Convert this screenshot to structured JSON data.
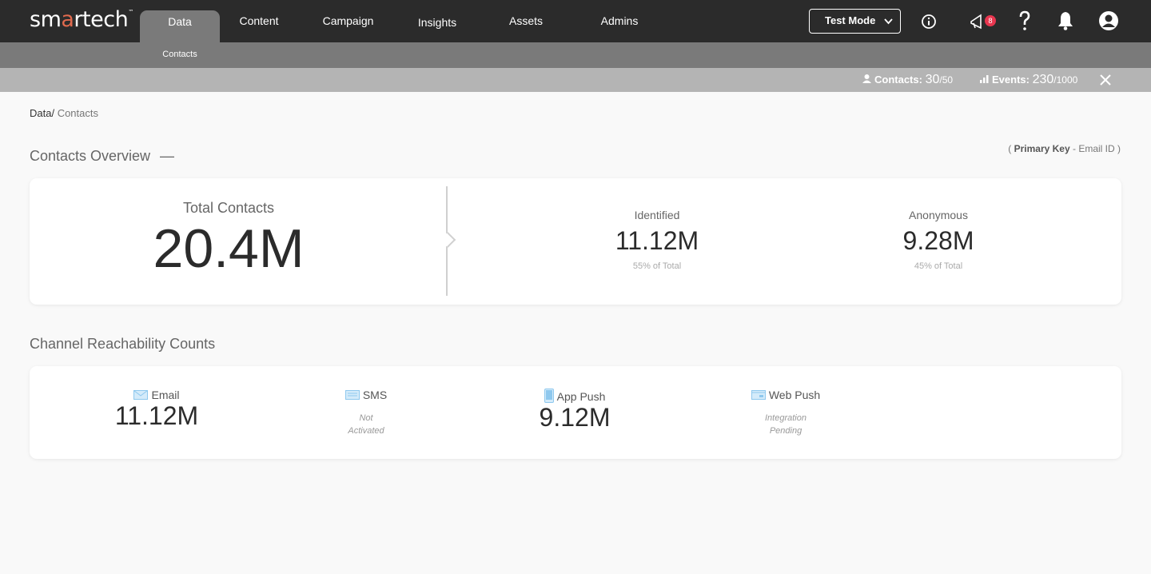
{
  "brand": {
    "name_pre": "sm",
    "name_a": "a",
    "name_post": "rtech",
    "tm": "™"
  },
  "nav": {
    "items": [
      {
        "label": "Data",
        "active": true
      },
      {
        "label": "Content"
      },
      {
        "label": "Campaign"
      },
      {
        "label": "Insights"
      },
      {
        "label": "Assets"
      },
      {
        "label": "Admins"
      }
    ],
    "sub_item": "Contacts"
  },
  "header": {
    "test_mode": "Test Mode",
    "notification_count": "8"
  },
  "quota": {
    "contacts_label": "Contacts:",
    "contacts_used": "30",
    "contacts_total": "/50",
    "events_label": "Events:",
    "events_used": "230",
    "events_total": "/1000"
  },
  "breadcrumb": {
    "root": "Data/",
    "current": " Contacts"
  },
  "overview": {
    "title": "Contacts Overview",
    "collapse": "—",
    "primary_key_open": "( ",
    "primary_key_label": "Primary Key",
    "primary_key_value": " - Email ID )",
    "total_label": "Total Contacts",
    "total_value": "20.4M",
    "identified_label": "Identified",
    "identified_value": "11.12M",
    "identified_sub": "55% of Total",
    "anonymous_label": "Anonymous",
    "anonymous_value": "9.28M",
    "anonymous_sub": "45% of Total"
  },
  "channels": {
    "title": "Channel Reachability Counts",
    "email": {
      "label": "Email",
      "value": "11.12M"
    },
    "sms": {
      "label": "SMS",
      "note1": "Not",
      "note2": "Activated"
    },
    "app_push": {
      "label": "App Push",
      "value": "9.12M"
    },
    "web_push": {
      "label": "Web Push",
      "note1": "Integration",
      "note2": "Pending"
    }
  },
  "colors": {
    "topbar": "#2b2b2b",
    "subbar": "#7a7a7a",
    "quotabar": "#b4b4b4",
    "accent": "#e06a4e",
    "badge": "#e8364f",
    "channel_icon": "#8ec8ee"
  }
}
